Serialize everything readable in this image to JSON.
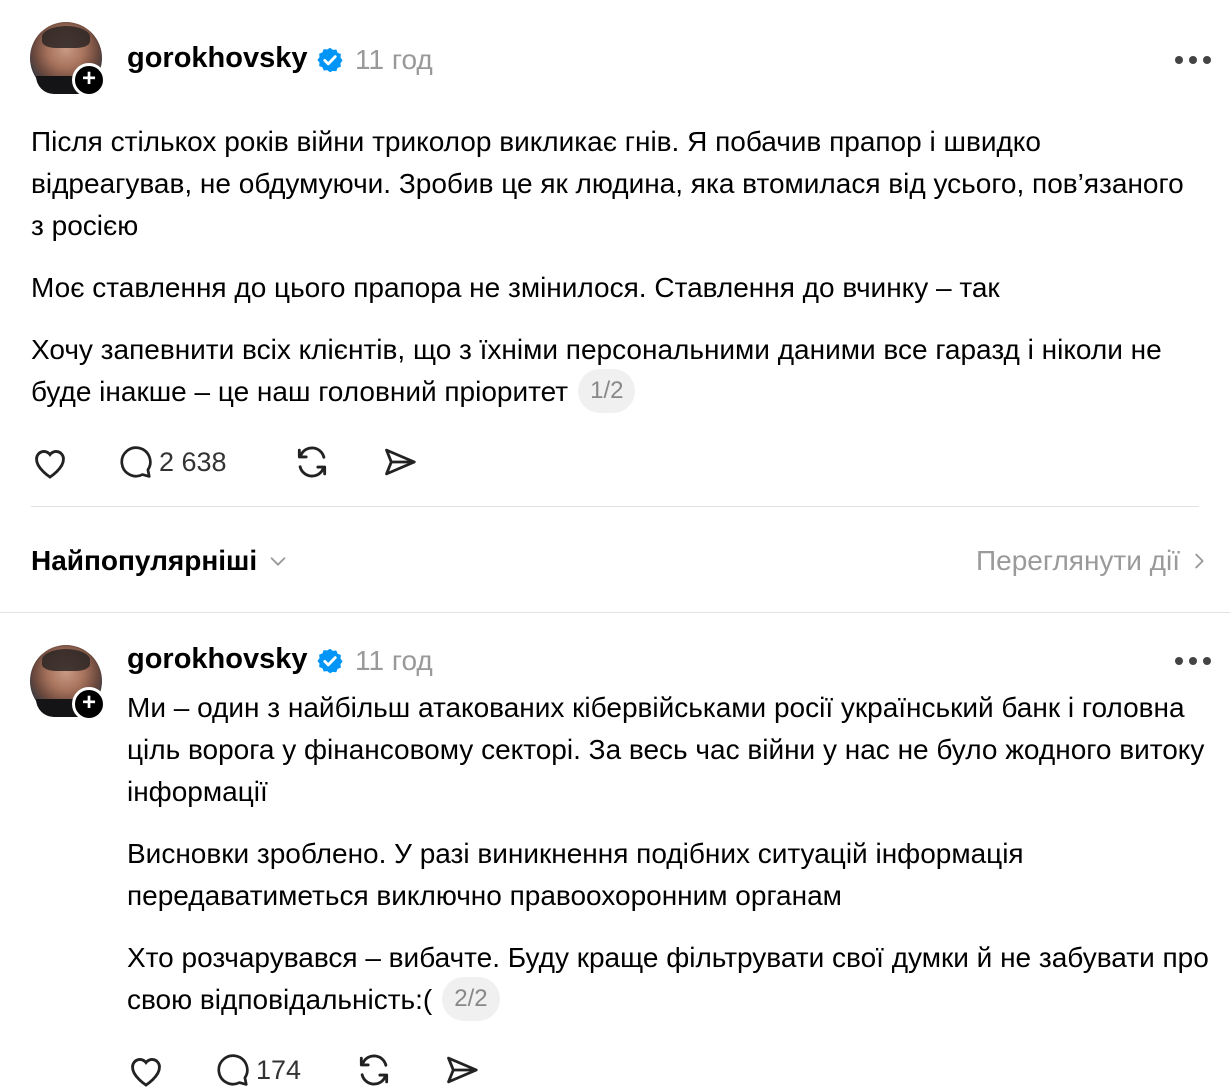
{
  "post1": {
    "username": "gorokhovsky",
    "timestamp": "11 год",
    "paragraphs": [
      "Після стількох років війни триколор викликає гнів. Я побачив прапор і швидко відреагував, не обдумуючи. Зробив це як людина, яка втомилася від усього, пов’язаного з росією",
      "Моє ставлення до цього прапора не змінилося. Ставлення до вчинку – так",
      "Хочу запевнити всіх клієнтів, що з їхніми персональними даними все гаразд і ніколи не буде інакше – це наш головний пріоритет"
    ],
    "thread_counter": "1/2",
    "reply_count": "2 638"
  },
  "sort_bar": {
    "sort_label": "Найпопулярніші",
    "view_activity_label": "Переглянути дії"
  },
  "post2": {
    "username": "gorokhovsky",
    "timestamp": "11 год",
    "paragraphs": [
      "Ми – один з найбільш атакованих кібервійськами росії український банк і головна ціль ворога у фінансовому секторі. За весь час війни у нас не було жодного витоку інформації",
      "Висновки зроблено. У разі виникнення подібних ситуацій інформація передаватиметься виключно правоохоронним органам",
      "Хто розчарувався – вибачте. Буду краще фільтрувати свої думки й не забувати про свою відповідальність:("
    ],
    "thread_counter": "2/2",
    "reply_count": "174"
  },
  "icons": {
    "verified": "verified-badge-icon",
    "like": "heart-icon",
    "reply": "comment-bubble-icon",
    "repost": "repost-icon",
    "share": "send-icon",
    "more": "more-options-icon",
    "follow": "plus-icon"
  },
  "colors": {
    "verified": "#0095f6",
    "muted_text": "#999999",
    "divider": "#e2e2e2"
  }
}
